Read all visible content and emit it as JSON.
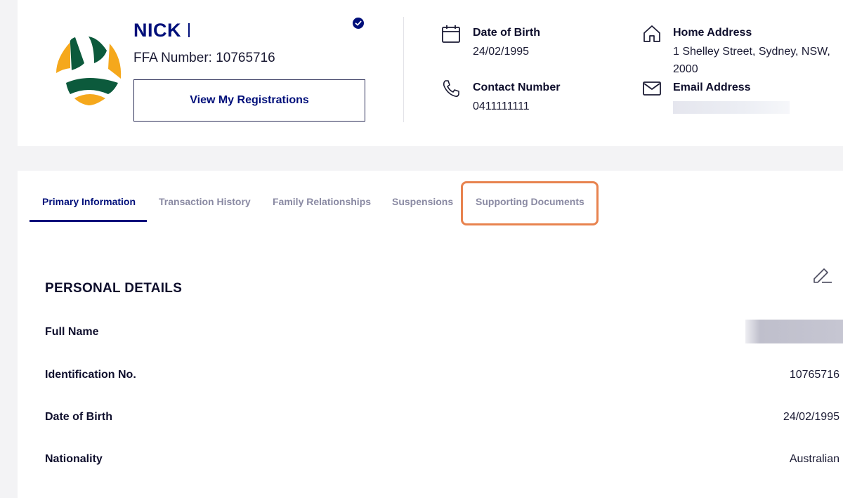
{
  "profile": {
    "name": "NICK",
    "ffa_label": "FFA Number:",
    "ffa_number": "10765716",
    "view_registrations_label": "View My Registrations",
    "verified_icon": "check-circle-icon",
    "logo_colors": {
      "green": "#0c5a3c",
      "gold": "#f5a81c"
    }
  },
  "contact": {
    "dob_label": "Date of Birth",
    "dob_value": "24/02/1995",
    "phone_label": "Contact Number",
    "phone_value": "0411111111",
    "address_label": "Home Address",
    "address_line1": "1 Shelley Street, Sydney, NSW,",
    "address_line2": "2000",
    "email_label": "Email Address",
    "email_value": ""
  },
  "tabs": [
    {
      "label": "Primary Information",
      "active": true
    },
    {
      "label": "Transaction History",
      "active": false
    },
    {
      "label": "Family Relationships",
      "active": false
    },
    {
      "label": "Suspensions",
      "active": false
    },
    {
      "label": "Supporting Documents",
      "active": false,
      "highlighted": true
    }
  ],
  "personal_details": {
    "title": "PERSONAL DETAILS",
    "rows": [
      {
        "label": "Full Name",
        "value": ""
      },
      {
        "label": "Identification No.",
        "value": "10765716"
      },
      {
        "label": "Date of Birth",
        "value": "24/02/1995"
      },
      {
        "label": "Nationality",
        "value": "Australian"
      }
    ]
  },
  "colors": {
    "brand_navy": "#000f7a",
    "highlight": "#e8834f",
    "muted_tab": "#8a8aa3"
  }
}
